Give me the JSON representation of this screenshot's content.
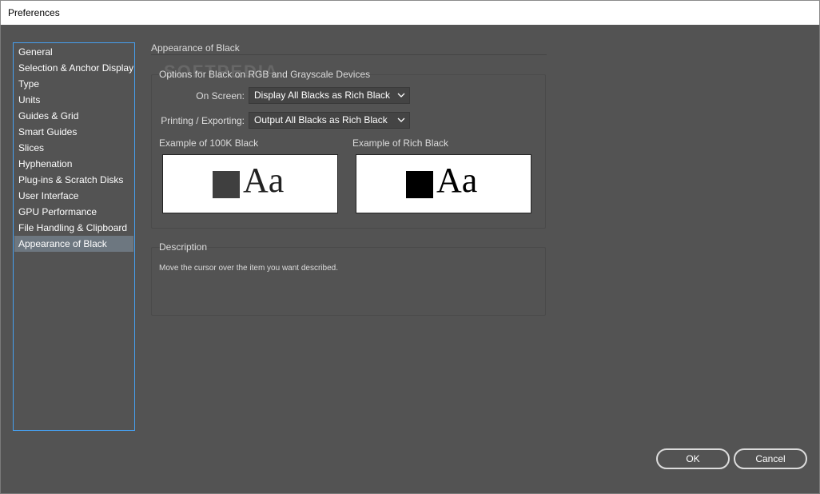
{
  "window": {
    "title": "Preferences"
  },
  "sidebar": {
    "items": [
      {
        "label": "General"
      },
      {
        "label": "Selection & Anchor Display"
      },
      {
        "label": "Type"
      },
      {
        "label": "Units"
      },
      {
        "label": "Guides & Grid"
      },
      {
        "label": "Smart Guides"
      },
      {
        "label": "Slices"
      },
      {
        "label": "Hyphenation"
      },
      {
        "label": "Plug-ins & Scratch Disks"
      },
      {
        "label": "User Interface"
      },
      {
        "label": "GPU Performance"
      },
      {
        "label": "File Handling & Clipboard"
      },
      {
        "label": "Appearance of Black"
      }
    ],
    "selected": "Appearance of Black"
  },
  "main": {
    "section_title": "Appearance of Black",
    "options_group": {
      "label": "Options for Black on RGB and Grayscale Devices",
      "on_screen": {
        "label": "On Screen:",
        "value": "Display All Blacks as Rich Black"
      },
      "printing": {
        "label": "Printing / Exporting:",
        "value": "Output All Blacks as Rich Black"
      },
      "example_100k": {
        "label": "Example of 100K Black",
        "text": "Aa",
        "swatch_color": "#3f3f3f"
      },
      "example_rich": {
        "label": "Example of Rich Black",
        "text": "Aa",
        "swatch_color": "#000000"
      }
    },
    "description_group": {
      "label": "Description",
      "text": "Move the cursor over the item you want described."
    }
  },
  "watermark": "SOFTPEDIA",
  "buttons": {
    "ok": "OK",
    "cancel": "Cancel"
  },
  "colors": {
    "accent": "#46a0f0",
    "background": "#535353",
    "selected_item": "#6d7780"
  }
}
